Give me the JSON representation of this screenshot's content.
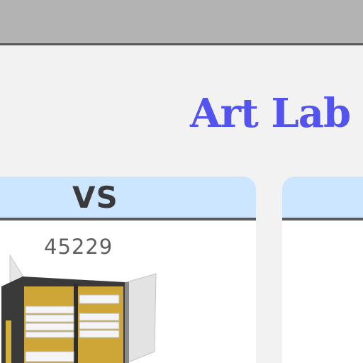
{
  "header": {
    "brand": "Art Lab"
  },
  "card": {
    "title": "VS",
    "code": "45229",
    "image_icon": "storage-cabinet-icon"
  },
  "colors": {
    "topbar": "#b3b3b3",
    "brand": "#5353ee",
    "card_header": "#cce6ff",
    "background": "#f2f2f2"
  }
}
